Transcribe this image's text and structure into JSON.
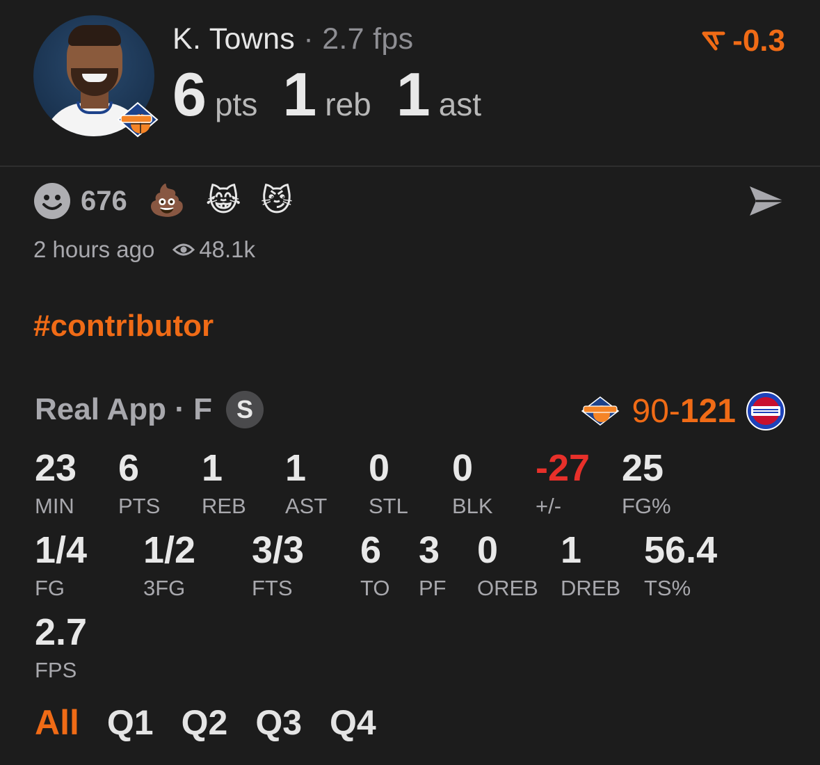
{
  "player": {
    "name": "K. Towns",
    "separator": "·",
    "fps_text": "2.7 fps",
    "pts": "6",
    "pts_label": "pts",
    "reb": "1",
    "reb_label": "reb",
    "ast": "1",
    "ast_label": "ast",
    "team_icon": "knicks-logo-icon"
  },
  "delta": {
    "value": "-0.3",
    "icon": "trend-down-icon",
    "color": "#f06b16"
  },
  "reactions": {
    "count": "676",
    "emojis": [
      "💩",
      "😹",
      "😼"
    ]
  },
  "meta": {
    "time": "2 hours ago",
    "views": "48.1k"
  },
  "hashtag": "#contributor",
  "game": {
    "source": "Real App · F",
    "badge": "S",
    "score_away": "90",
    "score_dash": "-",
    "score_home": "121",
    "home_icon": "pistons-logo-icon",
    "away_icon": "knicks-logo-icon"
  },
  "stats": {
    "row1": [
      {
        "v": "23",
        "k": "MIN"
      },
      {
        "v": "6",
        "k": "PTS"
      },
      {
        "v": "1",
        "k": "REB"
      },
      {
        "v": "1",
        "k": "AST"
      },
      {
        "v": "0",
        "k": "STL"
      },
      {
        "v": "0",
        "k": "BLK"
      },
      {
        "v": "-27",
        "k": "+/-"
      },
      {
        "v": "25",
        "k": "FG%"
      }
    ],
    "row2": [
      {
        "v": "1/4",
        "k": "FG"
      },
      {
        "v": "1/2",
        "k": "3FG"
      },
      {
        "v": "3/3",
        "k": "FTS"
      },
      {
        "v": "6",
        "k": "TO"
      },
      {
        "v": "3",
        "k": "PF"
      },
      {
        "v": "0",
        "k": "OREB"
      },
      {
        "v": "1",
        "k": "DREB"
      },
      {
        "v": "56.4",
        "k": "TS%"
      }
    ],
    "row3": [
      {
        "v": "2.7",
        "k": "FPS"
      }
    ]
  },
  "tabs": [
    "All",
    "Q1",
    "Q2",
    "Q3",
    "Q4"
  ],
  "colors": {
    "accent": "#f06b16",
    "negative": "#e8302a",
    "background": "#1c1c1c"
  }
}
